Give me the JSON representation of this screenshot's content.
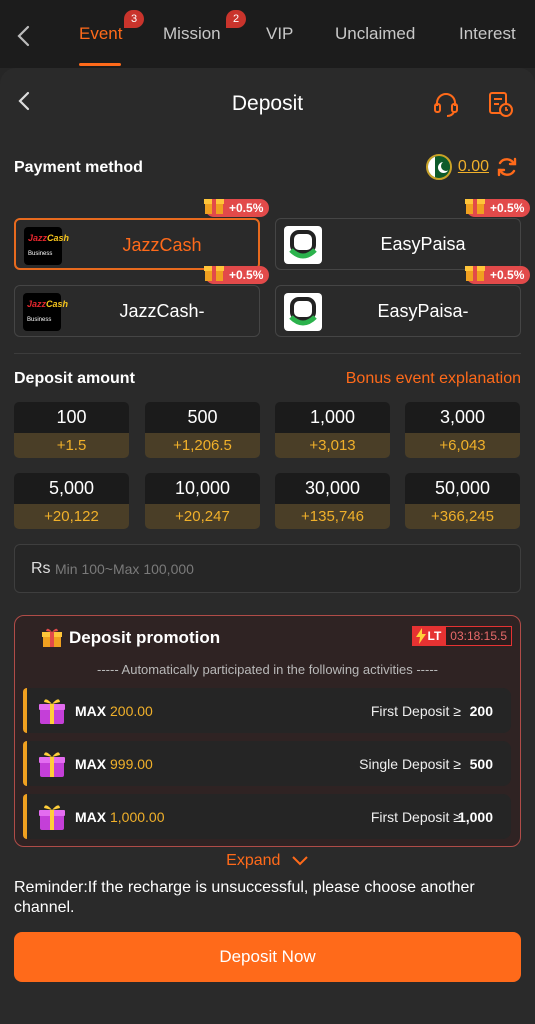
{
  "topbar": {
    "tabs": [
      {
        "label": "Event",
        "badge": "3",
        "active": true
      },
      {
        "label": "Mission",
        "badge": "2",
        "active": false
      },
      {
        "label": "VIP",
        "badge": "",
        "active": false
      },
      {
        "label": "Unclaimed",
        "badge": "",
        "active": false
      },
      {
        "label": "Interest",
        "badge": "",
        "active": false
      }
    ]
  },
  "header": {
    "title": "Deposit",
    "icons": [
      "back-icon",
      "headset-icon",
      "history-icon"
    ]
  },
  "payment": {
    "label": "Payment method",
    "balance": "0.00",
    "methods": [
      {
        "name": "JazzCash",
        "bonus": "+0.5%",
        "selected": true
      },
      {
        "name": "EasyPaisa",
        "bonus": "+0.5%",
        "selected": false
      },
      {
        "name": "JazzCash-",
        "bonus": "+0.5%",
        "selected": false
      },
      {
        "name": "EasyPaisa-",
        "bonus": "+0.5%",
        "selected": false
      }
    ],
    "jazz_logo": {
      "word1": "Jazz",
      "word2": "Cash",
      "sub": "Business"
    }
  },
  "amount": {
    "label": "Deposit amount",
    "bonus_link": "Bonus event explanation",
    "options": [
      {
        "value": "100",
        "bonus": "+1.5"
      },
      {
        "value": "500",
        "bonus": "+1,206.5"
      },
      {
        "value": "1,000",
        "bonus": "+3,013"
      },
      {
        "value": "3,000",
        "bonus": "+6,043"
      },
      {
        "value": "5,000",
        "bonus": "+20,122"
      },
      {
        "value": "10,000",
        "bonus": "+20,247"
      },
      {
        "value": "30,000",
        "bonus": "+135,746"
      },
      {
        "value": "50,000",
        "bonus": "+366,245"
      }
    ],
    "currency": "Rs",
    "placeholder": "Min 100~Max 100,000"
  },
  "promotion": {
    "title": "Deposit promotion",
    "lt_label": "LT",
    "timer": "03:18:15.5",
    "subtitle": "----- Automatically participated in the following activities -----",
    "rows": [
      {
        "max_label": "MAX",
        "max_value": "200.00",
        "condition": "First Deposit ≥",
        "condition_value": "200"
      },
      {
        "max_label": "MAX",
        "max_value": "999.00",
        "condition": "Single Deposit ≥",
        "condition_value": "500"
      },
      {
        "max_label": "MAX",
        "max_value": "1,000.00",
        "condition": "First Deposit ≥",
        "condition_value": "1,000"
      }
    ]
  },
  "expand_label": "Expand",
  "reminder": "Reminder:If the recharge is unsuccessful, please choose another channel.",
  "deposit_button": "Deposit Now",
  "colors": {
    "accent": "#ff6a1a",
    "gold": "#f0b02a",
    "badge_red": "#e24a4a",
    "background": "#262626"
  }
}
